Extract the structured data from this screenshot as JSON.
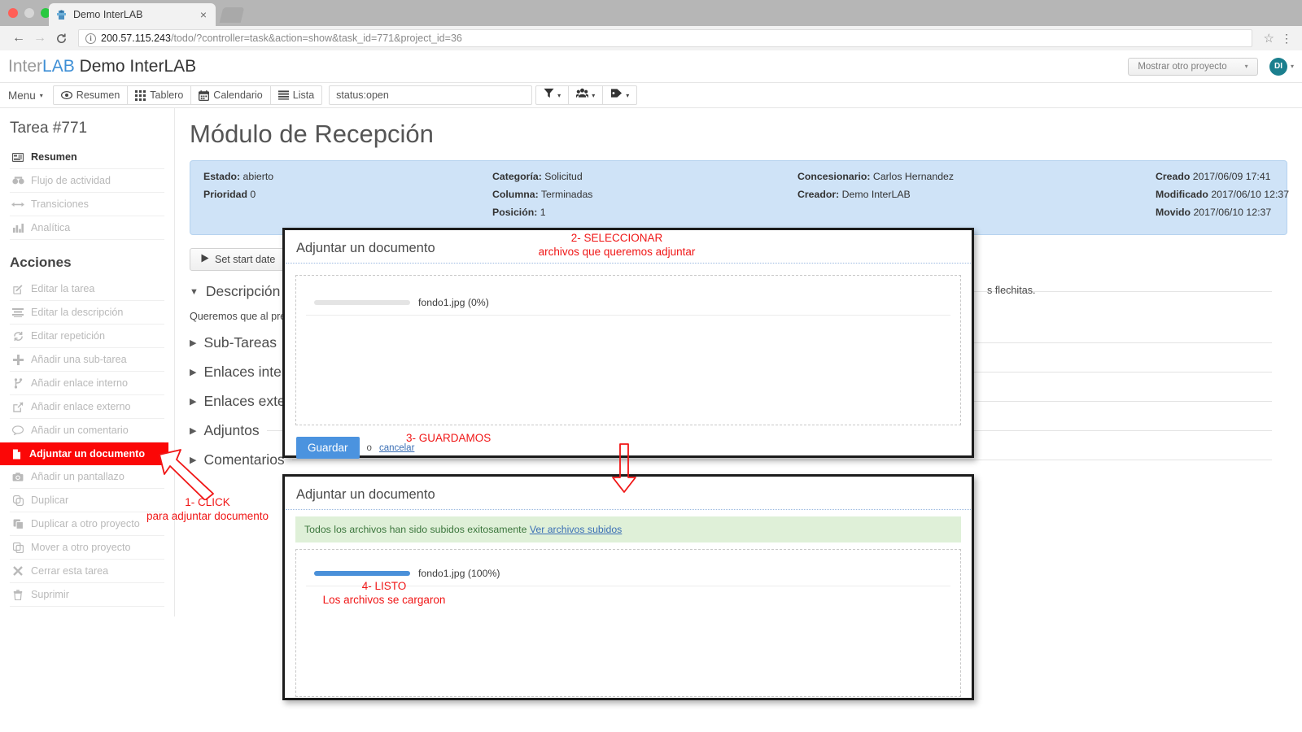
{
  "browser": {
    "tab_title": "Demo InterLAB",
    "tab_close_glyph": "×",
    "url_host": "200.57.115.243",
    "url_path": "/todo/?controller=task&action=show&task_id=771&project_id=36",
    "back_glyph": "←",
    "forward_glyph": "→",
    "reload_glyph": "C",
    "info_glyph": "i",
    "star_glyph": "☆",
    "menu_glyph": "⋮"
  },
  "header": {
    "brand_inter": "Inter",
    "brand_lab": "LAB",
    "brand_project": " Demo InterLAB",
    "project_selector": "Mostrar otro proyecto",
    "caret": "▾",
    "avatar_initials": "DI"
  },
  "navbar": {
    "menu_label": "Menu",
    "caret": "▾",
    "items": [
      {
        "label": "Resumen",
        "icon": "eye-icon"
      },
      {
        "label": "Tablero",
        "icon": "grid-icon"
      },
      {
        "label": "Calendario",
        "icon": "calendar-icon"
      },
      {
        "label": "Lista",
        "icon": "list-icon"
      }
    ],
    "search_value": "status:open",
    "search_placeholder": "",
    "filters": [
      {
        "icon": "funnel-icon",
        "caret": "▾"
      },
      {
        "icon": "users-icon",
        "caret": "▾"
      },
      {
        "icon": "tag-icon",
        "caret": "▾"
      }
    ]
  },
  "sidebar": {
    "task_title": "Tarea #771",
    "views": [
      {
        "label": "Resumen",
        "icon": "summary-icon",
        "active": true
      },
      {
        "label": "Flujo de actividad",
        "icon": "activity-icon",
        "active": false
      },
      {
        "label": "Transiciones",
        "icon": "arrows-icon",
        "active": false
      },
      {
        "label": "Analítica",
        "icon": "chart-icon",
        "active": false
      }
    ],
    "actions_heading": "Acciones",
    "actions": [
      {
        "label": "Editar la tarea",
        "icon": "edit-icon",
        "highlight": false
      },
      {
        "label": "Editar la descripción",
        "icon": "lines-icon",
        "highlight": false
      },
      {
        "label": "Editar repetición",
        "icon": "repeat-icon",
        "highlight": false
      },
      {
        "label": "Añadir una sub-tarea",
        "icon": "plus-icon",
        "highlight": false
      },
      {
        "label": "Añadir enlace interno",
        "icon": "branch-icon",
        "highlight": false
      },
      {
        "label": "Añadir enlace externo",
        "icon": "external-link-icon",
        "highlight": false
      },
      {
        "label": "Añadir un comentario",
        "icon": "comment-icon",
        "highlight": false
      },
      {
        "label": "Adjuntar un documento",
        "icon": "file-icon",
        "highlight": true
      },
      {
        "label": "Añadir un pantallazo",
        "icon": "camera-icon",
        "highlight": false
      },
      {
        "label": "Duplicar",
        "icon": "copy-icon",
        "highlight": false
      },
      {
        "label": "Duplicar a otro proyecto",
        "icon": "copy-project-icon",
        "highlight": false
      },
      {
        "label": "Mover a otro proyecto",
        "icon": "move-icon",
        "highlight": false
      },
      {
        "label": "Cerrar esta tarea",
        "icon": "close-icon",
        "highlight": false
      },
      {
        "label": "Suprimir",
        "icon": "trash-icon",
        "highlight": false
      }
    ]
  },
  "main": {
    "page_title": "Módulo de Recepción",
    "info": {
      "estado_label": "Estado:",
      "estado_value": " abierto",
      "prioridad_label": "Prioridad",
      "prioridad_value": " 0",
      "categoria_label": "Categoría:",
      "categoria_value": " Solicitud",
      "columna_label": "Columna:",
      "columna_value": " Terminadas",
      "posicion_label": "Posición:",
      "posicion_value": " 1",
      "concesionario_label": "Concesionario:",
      "concesionario_value": " Carlos Hernandez",
      "creador_label": "Creador:",
      "creador_value": " Demo InterLAB",
      "creado_label": "Creado",
      "creado_value": " 2017/06/09 17:41",
      "modificado_label": "Modificado",
      "modificado_value": " 2017/06/10 12:37",
      "movido_label": "Movido",
      "movido_value": " 2017/06/10 12:37"
    },
    "set_start_date": "Set start date",
    "sections": [
      {
        "label": "Descripción",
        "open": true
      },
      {
        "label": "Sub-Tareas",
        "open": false
      },
      {
        "label": "Enlaces internos",
        "open": false
      },
      {
        "label": "Enlaces externos",
        "open": false
      },
      {
        "label": "Adjuntos",
        "open": false
      },
      {
        "label": "Comentarios",
        "open": false
      }
    ],
    "description_left": "Queremos que al pres",
    "description_right": "s flechitas.",
    "triangle_open": "▼",
    "triangle_closed": "▶"
  },
  "dialog_upload": {
    "title": "Adjuntar un documento",
    "file_name": "fondo1.jpg (0%)",
    "progress_percent": 0,
    "save_label": "Guardar",
    "or_label": "o",
    "cancel_label": "cancelar"
  },
  "dialog_done": {
    "title": "Adjuntar un documento",
    "success_text": "Todos los archivos han sido subidos exitosamente ",
    "success_link": "Ver archivos subidos",
    "file_name": "fondo1.jpg (100%)",
    "progress_percent": 100
  },
  "annotations": {
    "step1_line1": "1- CLICK",
    "step1_line2": "para adjuntar documento",
    "step2_line1": "2- SELECCIONAR",
    "step2_line2": "archivos que queremos adjuntar",
    "step3": "3- GUARDAMOS",
    "step4_line1": "4- LISTO",
    "step4_line2": "Los archivos se cargaron",
    "color": "#f01616"
  }
}
